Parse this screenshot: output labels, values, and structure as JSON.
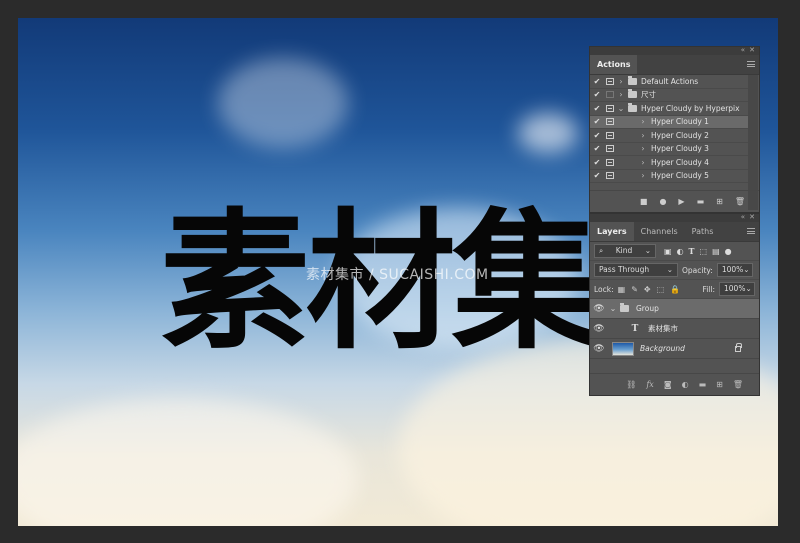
{
  "canvas": {
    "text": "素材集市",
    "watermark": "素材集市 / SUCAISHI.COM"
  },
  "actions_panel": {
    "tab_label": "Actions",
    "rows": [
      {
        "label": "Default Actions",
        "checked": true,
        "dialog": true,
        "type": "folder",
        "expanded": false,
        "selected": false
      },
      {
        "label": "尺寸",
        "checked": true,
        "dialog": false,
        "type": "folder",
        "expanded": false,
        "selected": false
      },
      {
        "label": "Hyper Cloudy by Hyperpix",
        "checked": true,
        "dialog": true,
        "type": "folder",
        "expanded": true,
        "selected": false
      },
      {
        "label": "Hyper Cloudy 1",
        "checked": true,
        "dialog": true,
        "type": "action",
        "selected": true
      },
      {
        "label": "Hyper Cloudy 2",
        "checked": true,
        "dialog": true,
        "type": "action",
        "selected": false
      },
      {
        "label": "Hyper Cloudy 3",
        "checked": true,
        "dialog": true,
        "type": "action",
        "selected": false
      },
      {
        "label": "Hyper Cloudy 4",
        "checked": true,
        "dialog": true,
        "type": "action",
        "selected": false
      },
      {
        "label": "Hyper Cloudy 5",
        "checked": true,
        "dialog": true,
        "type": "action",
        "selected": false
      }
    ],
    "toolbar_icons": [
      "stop-icon",
      "record-icon",
      "play-icon",
      "new-set-icon",
      "new-action-icon",
      "trash-icon"
    ]
  },
  "layers_panel": {
    "tabs": [
      {
        "label": "Layers",
        "active": true
      },
      {
        "label": "Channels",
        "active": false
      },
      {
        "label": "Paths",
        "active": false
      }
    ],
    "filter_kind": "Kind",
    "blend_mode": "Pass Through",
    "opacity_label": "Opacity:",
    "opacity_value": "100%",
    "lock_label": "Lock:",
    "fill_label": "Fill:",
    "fill_value": "100%",
    "layers": [
      {
        "name": "Group",
        "type": "group",
        "selected": true
      },
      {
        "name": "素材集市",
        "type": "text",
        "selected": false
      },
      {
        "name": "Background",
        "type": "image",
        "selected": false,
        "locked": true
      }
    ],
    "toolbar_icons": [
      "link-icon",
      "fx-icon",
      "mask-icon",
      "adjustment-icon",
      "group-icon",
      "new-layer-icon",
      "trash-icon"
    ]
  },
  "colors": {
    "panel_bg": "#535353",
    "tab_bar_bg": "#424242",
    "selected_row": "#6a6a6a",
    "workspace_bg": "#2b2b2b"
  }
}
